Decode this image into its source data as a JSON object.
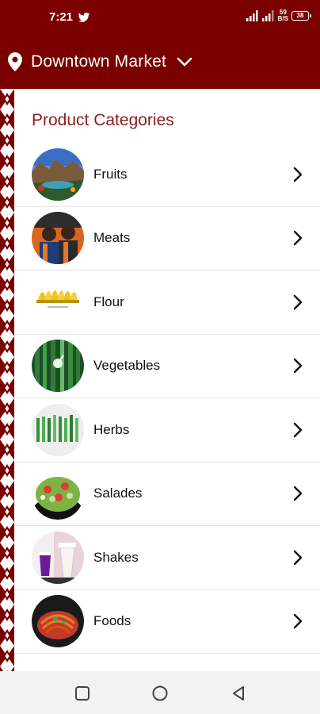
{
  "status_bar": {
    "time": "7:21",
    "speed_top": "59",
    "speed_bottom": "B/S",
    "battery": "38"
  },
  "header": {
    "title": "Downtown Market",
    "location_icon": "location-pin-icon",
    "dropdown_icon": "chevron-down-icon"
  },
  "section": {
    "title": "Product Categories"
  },
  "categories": [
    {
      "label": "Fruits"
    },
    {
      "label": "Meats"
    },
    {
      "label": "Flour"
    },
    {
      "label": "Vegetables"
    },
    {
      "label": "Herbs"
    },
    {
      "label": "Salades"
    },
    {
      "label": "Shakes"
    },
    {
      "label": "Foods"
    }
  ],
  "nav": {
    "recent_icon": "square-icon",
    "home_icon": "circle-icon",
    "back_icon": "triangle-back-icon"
  },
  "colors": {
    "primary": "#7a0000",
    "title": "#8c1d1d",
    "nav_background": "#f2f2f2"
  }
}
